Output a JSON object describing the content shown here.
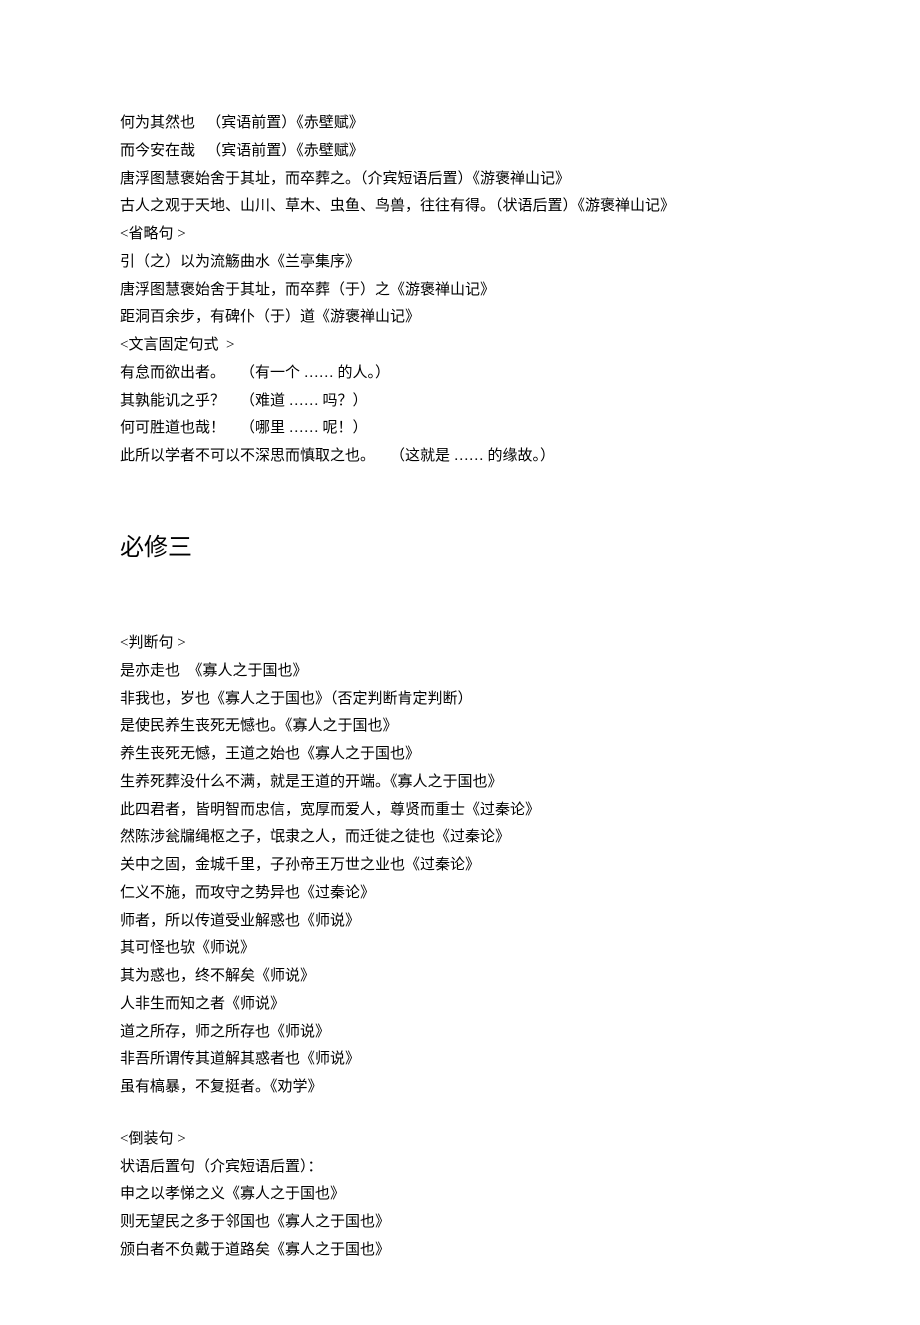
{
  "block1": [
    "何为其然也   （宾语前置）《赤壁赋》",
    "而今安在哉   （宾语前置）《赤壁赋》",
    "唐浮图慧褒始舍于其址，而卒葬之。（介宾短语后置）《游褒禅山记》",
    "古人之观于天地、山川、草木、虫鱼、鸟兽，往往有得。（状语后置）《游褒禅山记》",
    "<省略句 >",
    "引（之）以为流觞曲水《兰亭集序》",
    "唐浮图慧褒始舍于其址，而卒葬（于）之《游褒禅山记》",
    "距洞百余步，有碑仆（于）道《游褒禅山记》",
    "<文言固定句式  >",
    "有怠而欲出者。    （有一个 …… 的人。）",
    "其孰能讥之乎？    （难道 …… 吗？）",
    "何可胜道也哉！    （哪里 …… 呢！）",
    "此所以学者不可以不深思而慎取之也。    （这就是 …… 的缘故。）"
  ],
  "heading": "必修三",
  "block2": [
    "<判断句 >",
    "是亦走也  《寡人之于国也》",
    "非我也，岁也《寡人之于国也》（否定判断肯定判断）",
    "是使民养生丧死无憾也。《寡人之于国也》",
    "养生丧死无憾，王道之始也《寡人之于国也》",
    "生养死葬没什么不满，就是王道的开端。《寡人之于国也》",
    "此四君者，皆明智而忠信，宽厚而爱人，尊贤而重士《过秦论》",
    "然陈涉瓮牖绳枢之子，氓隶之人，而迁徙之徒也《过秦论》",
    "关中之固，金城千里，子孙帝王万世之业也《过秦论》",
    "仁义不施，而攻守之势异也《过秦论》",
    "师者，所以传道受业解惑也《师说》",
    "其可怪也欤《师说》",
    "其为惑也，终不解矣《师说》",
    "人非生而知之者《师说》",
    "道之所存，师之所存也《师说》",
    "非吾所谓传其道解其惑者也《师说》",
    "虽有槁暴，不复挺者。《劝学》"
  ],
  "block3": [
    "<倒装句 >",
    "状语后置句（介宾短语后置）：",
    "申之以孝悌之义《寡人之于国也》",
    "则无望民之多于邻国也《寡人之于国也》",
    "颁白者不负戴于道路矣《寡人之于国也》"
  ]
}
